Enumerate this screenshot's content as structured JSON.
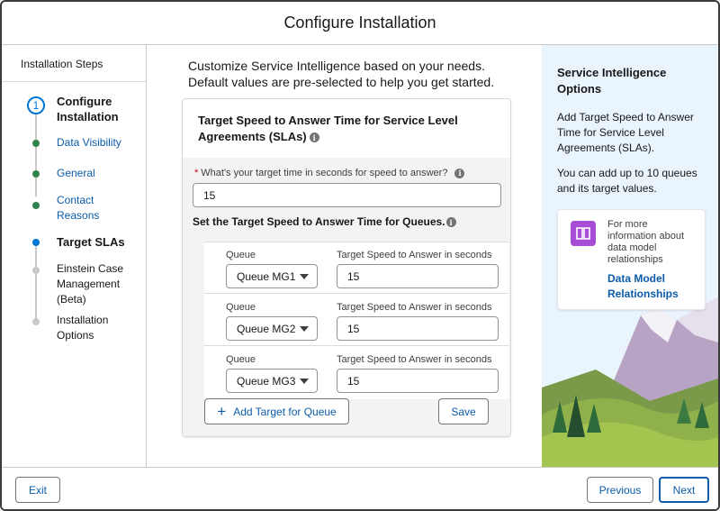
{
  "header": {
    "title": "Configure Installation"
  },
  "sidebar": {
    "heading": "Installation Steps",
    "steps": [
      {
        "number": "1",
        "label": "Configure Installation",
        "state": "current"
      },
      {
        "label": "Data Visibility",
        "state": "done"
      },
      {
        "label": "General",
        "state": "done"
      },
      {
        "label": "Contact Reasons",
        "state": "done"
      },
      {
        "label": "Target SLAs",
        "state": "active"
      },
      {
        "label": "Einstein Case Management (Beta)",
        "state": "todo"
      },
      {
        "label": "Installation Options",
        "state": "todo"
      }
    ]
  },
  "main": {
    "intro": "Customize Service Intelligence based on your needs. Default values are pre-selected to help you get started.",
    "card": {
      "title": "Target Speed to Answer Time for Service Level Agreements (SLAs)",
      "field_required_marker": "*",
      "field_label": "What's your target time in seconds for speed to answer?",
      "field_value": "15",
      "queues_title": "Set the Target Speed to Answer Time for Queues.",
      "queue_rows": [
        {
          "queue_label": "Queue",
          "queue_value": "Queue MG1",
          "target_label": "Target Speed to Answer in seconds",
          "target_value": "15"
        },
        {
          "queue_label": "Queue",
          "queue_value": "Queue MG2",
          "target_label": "Target Speed to Answer in seconds",
          "target_value": "15"
        },
        {
          "queue_label": "Queue",
          "queue_value": "Queue MG3",
          "target_label": "Target Speed to Answer in seconds",
          "target_value": "15"
        }
      ],
      "add_button": "Add Target for Queue",
      "save_button": "Save"
    }
  },
  "help": {
    "title": "Service Intelligence Options",
    "text1": "Add Target Speed to Answer Time for Service Level Agreements (SLAs).",
    "text2": "You can add up to 10 queues and its target values.",
    "card_text": "For more information about data model relationships",
    "card_link": "Data Model Relationships",
    "card_icon": "book-icon"
  },
  "footer": {
    "exit": "Exit",
    "previous": "Previous",
    "next": "Next"
  },
  "colors": {
    "brand": "#0176d3",
    "link": "#0b5cab",
    "done": "#2e844a",
    "help_bg": "#eaf4fd",
    "icon_purple": "#a84dd6"
  }
}
